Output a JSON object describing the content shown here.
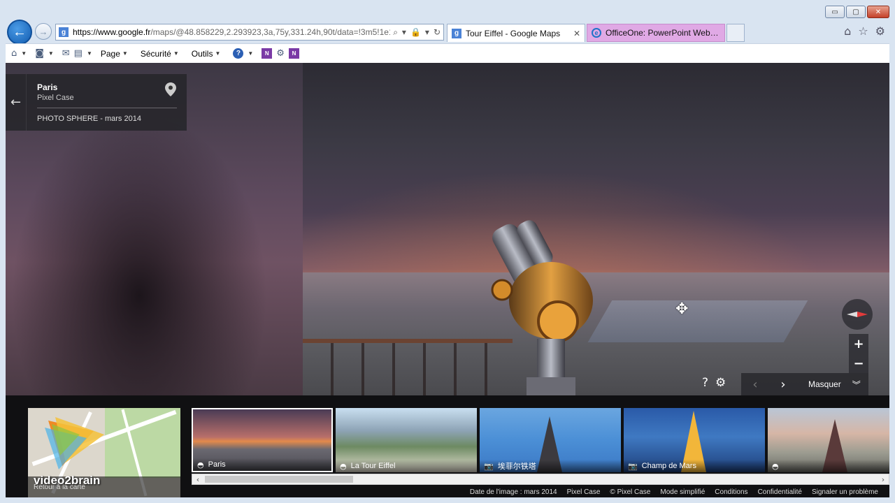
{
  "browser": {
    "caption_buttons": {
      "minimize": "▭",
      "maximize": "▢",
      "close": "✕"
    },
    "address": {
      "favicon": "g",
      "url_host": "https://www.google.fr",
      "url_rest": "/maps/@48.858229,2.293923,3a,75y,331.24h,90t/data=!3m5!1e1!3r",
      "search_icon": "⌕",
      "lock_icon": "🔒",
      "dropdown_icon": "▾",
      "refresh_icon": "↻"
    },
    "tabs": [
      {
        "label": "Tour Eiffel - Google Maps",
        "close": "✕"
      },
      {
        "label": "OfficeOne: PowerPoint Web B..."
      }
    ],
    "right_icons": {
      "home": "⌂",
      "favorites": "☆",
      "settings": "⚙"
    },
    "commandbar": {
      "page": "Page",
      "security": "Sécurité",
      "tools": "Outils",
      "help": "?",
      "onenote": "N"
    }
  },
  "streetview": {
    "info": {
      "title": "Paris",
      "subtitle": "Pixel Case",
      "type": "PHOTO SPHERE - mars 2014"
    },
    "controls": {
      "zoom_in": "+",
      "zoom_out": "−",
      "help": "?",
      "settings": "⚙",
      "prev": "‹",
      "next": "›",
      "hide_label": "Masquer",
      "hide_icon": "︾"
    }
  },
  "strip": {
    "minimap_caption": "Retour à la carte",
    "logo_text": "video2brain",
    "thumbnails": [
      {
        "label": "Paris",
        "icon": "◓"
      },
      {
        "label": "La Tour Eiffel",
        "icon": "◓"
      },
      {
        "label": "埃菲尔铁塔",
        "icon": "📷"
      },
      {
        "label": "Champ de Mars",
        "icon": "📷"
      },
      {
        "label": "",
        "icon": "◓"
      }
    ],
    "scroll": {
      "left": "‹",
      "right": "›"
    },
    "footer": [
      "Date de l'image : mars 2014",
      "Pixel Case",
      "© Pixel Case",
      "Mode simplifié",
      "Conditions",
      "Confidentialité",
      "Signaler un problème"
    ]
  }
}
